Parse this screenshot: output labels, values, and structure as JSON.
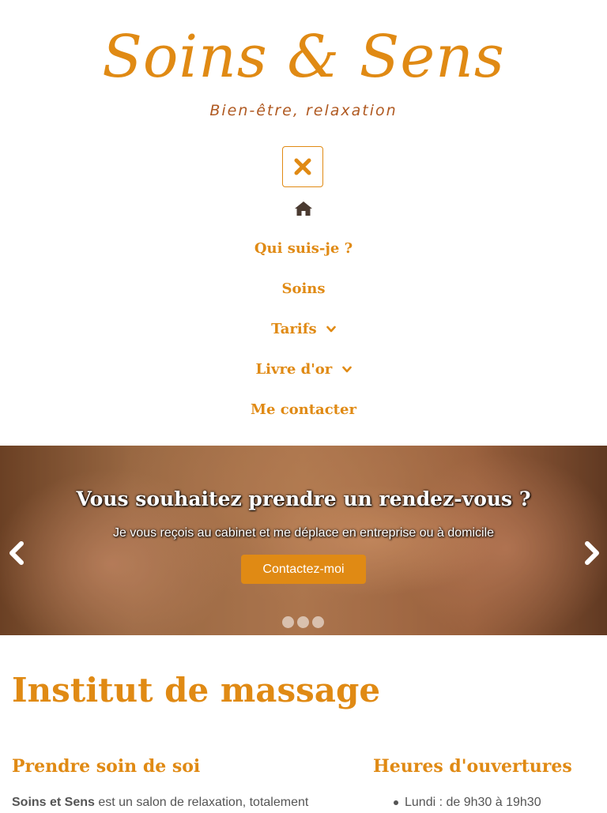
{
  "brand": {
    "name": "Soins & Sens",
    "tagline": "Bien-être, relaxation",
    "accent_color": "#e08a14"
  },
  "nav": {
    "toggle_icon": "close-icon",
    "home_icon": "home-icon",
    "items": [
      {
        "label": "Qui suis-je ?",
        "has_dropdown": false
      },
      {
        "label": "Soins",
        "has_dropdown": false
      },
      {
        "label": "Tarifs",
        "has_dropdown": true
      },
      {
        "label": "Livre d'or",
        "has_dropdown": true
      },
      {
        "label": "Me contacter",
        "has_dropdown": false
      }
    ]
  },
  "hero": {
    "title": "Vous souhaitez prendre un rendez-vous ?",
    "subtitle": "Je vous reçois au cabinet et me déplace en entreprise ou à domicile",
    "button": "Contactez-moi",
    "slide_count": 3
  },
  "main": {
    "title": "Institut de massage",
    "left": {
      "heading": "Prendre soin de soi",
      "intro_bold": "Soins et Sens",
      "intro_rest": " est un salon de relaxation, totalement"
    },
    "right": {
      "heading": "Heures d'ouvertures",
      "hours": [
        "Lundi : de 9h30 à 19h30"
      ]
    }
  }
}
